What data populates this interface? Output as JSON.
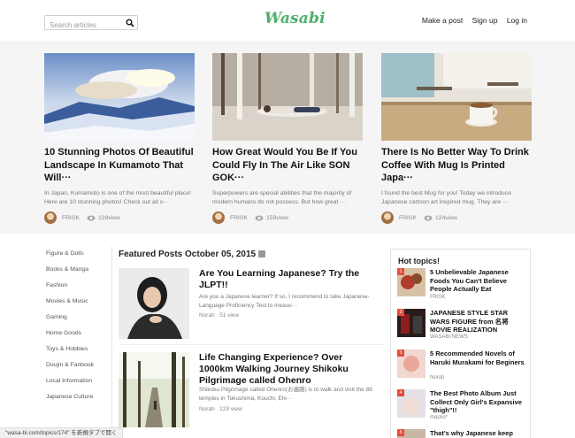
{
  "header": {
    "search_placeholder": "Search articles",
    "logo": "Wasabi",
    "nav": [
      "Make a post",
      "Sign up",
      "Log in"
    ],
    "logo_color": "#4db06b"
  },
  "top_cards": [
    {
      "title": "10 Stunning Photos Of Beautiful Landscape In Kumamoto That Will···",
      "excerpt": "In Japan, Kumamoto is one of the most beautiful place! Here are 10 stunning photos! Check out all o···",
      "author": "FRISK",
      "views": "128view"
    },
    {
      "title": "How Great Would You Be If You Could Fly In The Air Like SON GOK···",
      "excerpt": "Superpowers are special abilities that the majority of modern humans do not possess. But how great ···",
      "author": "FRISK",
      "views": "159view"
    },
    {
      "title": "There Is No Better Way To Drink Coffee With Mug Is Printed Japa···",
      "excerpt": "I found the best Mug for you! Today we introduce Japanese cartoon art inspired mug. They are ···",
      "author": "FRISK",
      "views": "124view"
    }
  ],
  "categories": [
    "Figure & Dolls",
    "Books & Manga",
    "Fashion",
    "Movies & Music",
    "Gaming",
    "Home Goods",
    "Toys & Hobbies",
    "Doujin & Fanbook",
    "Local Information",
    "Japanese Culture"
  ],
  "featured": {
    "heading": "Featured Posts October 05, 2015",
    "posts": [
      {
        "title": "Are You Learning Japanese? Try the JLPT!!",
        "excerpt": "Are you a Japanese learner? If so, I recommend to take Japanese-Language Proficiency Test to measu···",
        "author": "Norah",
        "views": "51 view"
      },
      {
        "title": "Life Changing Experience? Over 1000km Walking Journey Shikoku Pilgrimage called Ohenro",
        "excerpt": "Shikoku Pilgrimage called Ohenro(お遍路) is to walk and visit the 88 temples in Tokushima, Kouchi, Ehi···",
        "author": "Norah",
        "views": "129 view"
      }
    ]
  },
  "hot_topics": {
    "heading": "Hot topics!",
    "items": [
      {
        "num": "1",
        "title": "5 Unbelievable Japanese Foods You Can't Believe People Actually Eat",
        "source": "FRISK"
      },
      {
        "num": "2",
        "title": "JAPANESE STYLE STAR WARS FIGURE from 名将 MOVIE REALIZATION",
        "source": "WASABI NEWS"
      },
      {
        "num": "3",
        "title": "5 Recommended Novels of Haruki Murakami for Beginers",
        "source": "Norah"
      },
      {
        "num": "4",
        "title": "The Best Photo Album Just Collect Only Girl's Expansive \"thigh\"!!",
        "source": "macko*"
      },
      {
        "num": "5",
        "title": "That's why Japanese keep",
        "source": ""
      }
    ]
  },
  "status_bar": "\"wasa-bi.com/topics/174\" を新規タブで開く"
}
